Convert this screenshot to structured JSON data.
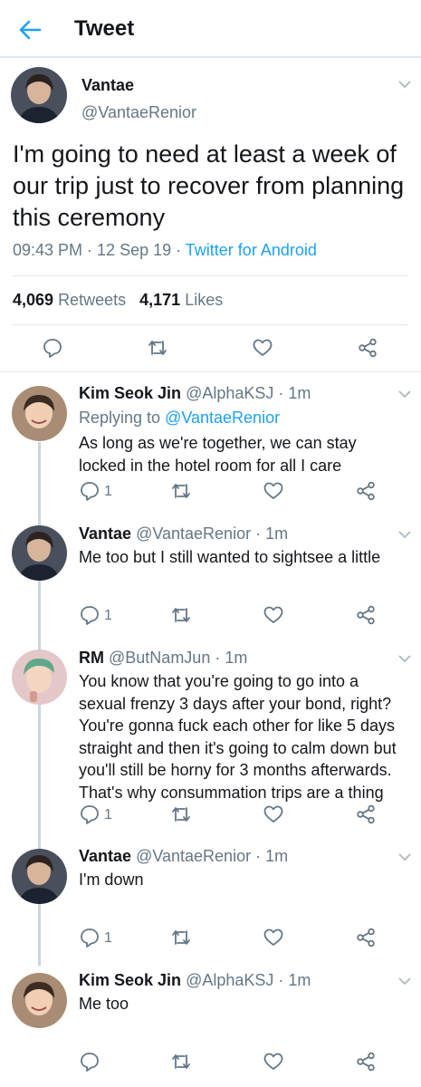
{
  "header": {
    "title": "Tweet"
  },
  "main_tweet": {
    "name": "Vantae",
    "handle": "@VantaeRenior",
    "text": "I'm going to need at least a week of our trip just to recover from planning this ceremony",
    "time_date": "09:43 PM · 12 Sep 19 · ",
    "source": "Twitter for Android",
    "retweets_count": "4,069",
    "retweets_label": "Retweets",
    "likes_count": "4,171",
    "likes_label": "Likes"
  },
  "replies": [
    {
      "name": "Kim Seok Jin",
      "handle": "@AlphaKSJ · 1m",
      "replying_label": "Replying to ",
      "replying_to": "@VantaeRenior",
      "text": "As long as we're together, we can stay locked in the hotel room for all I care",
      "reply_count": "1"
    },
    {
      "name": "Vantae",
      "handle": "@VantaeRenior · 1m",
      "text": "Me too but I still wanted to sightsee a little",
      "reply_count": "1"
    },
    {
      "name": "RM",
      "handle": "@ButNamJun · 1m",
      "text": "You know that you're going to go into a sexual frenzy 3 days after your bond, right? You're gonna fuck each other for like 5 days straight and then it's going to calm down but you'll still be horny for 3 months afterwards. That's why consummation trips are a thing",
      "reply_count": "1"
    },
    {
      "name": "Vantae",
      "handle": "@VantaeRenior · 1m",
      "text": "I'm down",
      "reply_count": "1"
    },
    {
      "name": "Kim Seok Jin",
      "handle": "@AlphaKSJ · 1m",
      "text": "Me too",
      "reply_count": ""
    }
  ],
  "icons": {
    "back": "back-arrow-icon",
    "reply": "reply-icon",
    "retweet": "retweet-icon",
    "like": "heart-icon",
    "share": "share-icon",
    "more": "chevron-down-icon"
  },
  "colors": {
    "accent": "#1da1f2",
    "muted": "#657786",
    "divider": "#e1e8ed",
    "thread": "#ccd6dd"
  }
}
